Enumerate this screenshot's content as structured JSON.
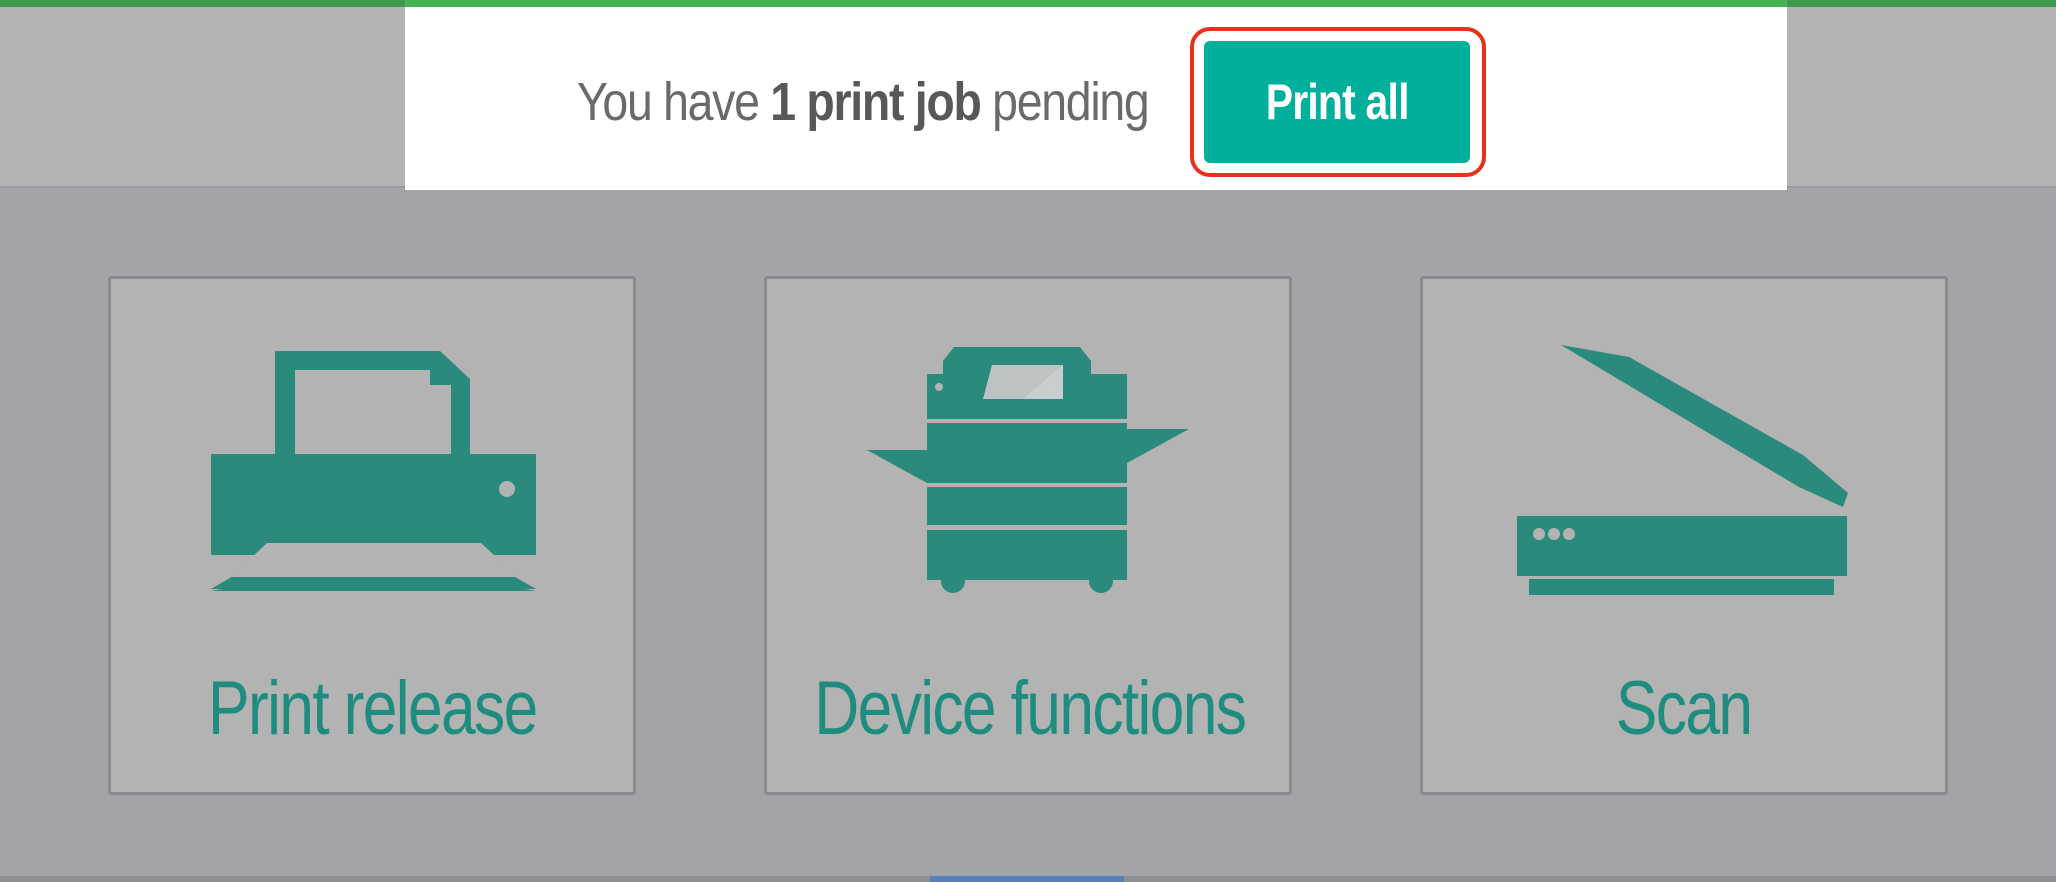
{
  "notice": {
    "prefix": "You have",
    "count_text": "1 print job",
    "suffix": "pending",
    "button_label": "Print all"
  },
  "tiles": [
    {
      "label": "Print release",
      "icon": "printer-icon"
    },
    {
      "label": "Device functions",
      "icon": "copier-icon"
    },
    {
      "label": "Scan",
      "icon": "scanner-icon"
    }
  ],
  "colors": {
    "accent_teal": "#00b09b",
    "icon_teal": "#2a8a7c",
    "highlight_red": "#e4321b",
    "top_green": "#48b356",
    "background_gray": "#a3a4a8",
    "tile_gray": "#b3b3b3"
  }
}
